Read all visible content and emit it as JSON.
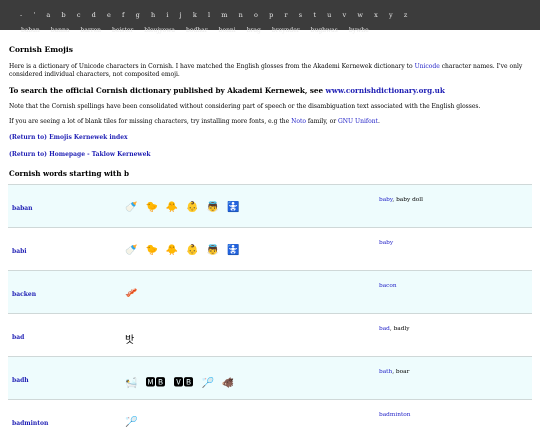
{
  "nav": {
    "letters": [
      "-",
      "'",
      "a",
      "b",
      "c",
      "d",
      "e",
      "f",
      "g",
      "h",
      "i",
      "j",
      "k",
      "l",
      "m",
      "n",
      "o",
      "p",
      "r",
      "s",
      "t",
      "u",
      "v",
      "w",
      "x",
      "y",
      "z"
    ],
    "words": [
      "baban",
      "banna",
      "barren",
      "beister",
      "bleujyowa",
      "bodhar",
      "bonni",
      "brag",
      "breynder",
      "bughwas",
      "bywhe"
    ]
  },
  "page": {
    "title": "Cornish Emojis",
    "intro_1": "Here is a dictionary of Unicode characters in Cornish. I have matched the English glosses from the Akademi Kernewek dictionary to ",
    "intro_link": "Unicode",
    "intro_2": " character names. I've only considered individual characters, not composited emoji.",
    "search_heading": "To search the official Cornish dictionary published by Akademi Kernewek, see ",
    "search_link": "www.cornishdictionary.org.uk",
    "note": "Note that the Cornish spellings have been consolidated without considering part of speech or the disambiguation text associated with the English glosses.",
    "fonts_1": "If you are seeing a lot of blank tiles for missing characters, try installing more fonts, e.g the ",
    "fonts_link1": "Noto",
    "fonts_2": " family, or ",
    "fonts_link2": "GNU Unifont",
    "fonts_3": ".",
    "return_index": "(Return to) Emojis Kernewek index",
    "return_home": "(Return to) Homepage - Taklow Kernewek",
    "section_heading": "Cornish words starting with b"
  },
  "rows": [
    {
      "word": "baban",
      "emojis": [
        "🍼",
        "🐤",
        "🐥",
        "👶",
        "👼",
        "🚼"
      ],
      "gloss_link": "baby",
      "gloss_rest": ", baby doll"
    },
    {
      "word": "babi",
      "emojis": [
        "🍼",
        "🐤",
        "🐥",
        "👶",
        "👼",
        "🚼"
      ],
      "gloss_link": "baby",
      "gloss_rest": ""
    },
    {
      "word": "backen",
      "emojis": [
        "🥓"
      ],
      "gloss_link": "bacon",
      "gloss_rest": ""
    },
    {
      "word": "bad",
      "emojis": [
        "밧"
      ],
      "gloss_link": "bad",
      "gloss_rest": ", badly"
    },
    {
      "word": "badh",
      "emojis": [
        "🛀",
        "🅼🅱",
        "🆅🅱",
        "🏸",
        "🐗"
      ],
      "gloss_link": "bath",
      "gloss_rest": ", boar"
    },
    {
      "word": "badminton",
      "emojis": [
        "🏸"
      ],
      "gloss_link": "badminton",
      "gloss_rest": ""
    }
  ]
}
